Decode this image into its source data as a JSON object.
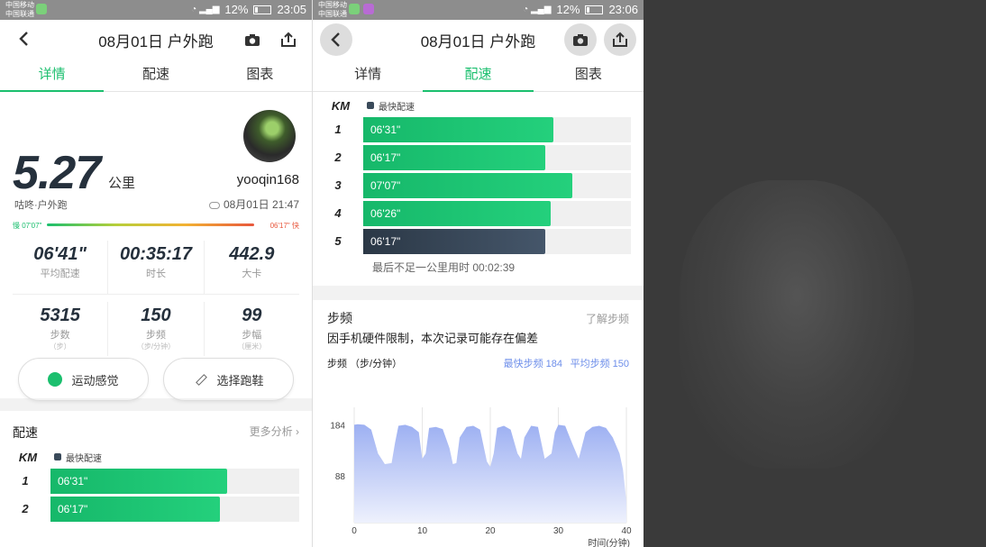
{
  "status": {
    "carrier1": "中国移动",
    "carrier2": "中国联通",
    "battery": "12%",
    "time_left": "23:05",
    "time_right": "23:06",
    "net": "4G"
  },
  "header": {
    "title": "08月01日 户外跑"
  },
  "tabs": [
    {
      "label": "详情"
    },
    {
      "label": "配速"
    },
    {
      "label": "图表"
    }
  ],
  "summary": {
    "distance": "5.27",
    "distance_unit": "公里",
    "subtype": "咕咚·户外跑",
    "username": "yooqin168",
    "datetime": "08月01日 21:47",
    "slow_label": "慢 07'07\"",
    "fast_label": "06'17\" 快"
  },
  "stats_row1": [
    {
      "value": "06'41\"",
      "label": "平均配速",
      "unit": ""
    },
    {
      "value": "00:35:17",
      "label": "时长",
      "unit": ""
    },
    {
      "value": "442.9",
      "label": "大卡",
      "unit": ""
    }
  ],
  "stats_row2": [
    {
      "value": "5315",
      "label": "步数",
      "unit": "（步）"
    },
    {
      "value": "150",
      "label": "步频",
      "unit": "（步/分钟）"
    },
    {
      "value": "99",
      "label": "步幅",
      "unit": "（厘米）"
    }
  ],
  "buttons": {
    "feel": "运动感觉",
    "shoes": "选择跑鞋"
  },
  "pace_section": {
    "title": "配速",
    "more": "更多分析 ›",
    "km": "KM",
    "legend": "最快配速"
  },
  "pace_rows": [
    {
      "km": "1",
      "pace": "06'31\"",
      "frac": 0.71,
      "fastest": false
    },
    {
      "km": "2",
      "pace": "06'17\"",
      "frac": 0.68,
      "fastest": false
    },
    {
      "km": "3",
      "pace": "07'07\"",
      "frac": 0.78,
      "fastest": false
    },
    {
      "km": "4",
      "pace": "06'26\"",
      "frac": 0.7,
      "fastest": false
    },
    {
      "km": "5",
      "pace": "06'17\"",
      "frac": 0.68,
      "fastest": true
    }
  ],
  "remain": "最后不足一公里用时 00:02:39",
  "cadence": {
    "title": "步频",
    "more": "了解步频",
    "note": "因手机硬件限制，本次记录可能存在偏差",
    "ylabel": "步频 （步/分钟）",
    "max_label": "最快步频 184",
    "avg_label": "平均步频 150"
  },
  "chart_data": {
    "type": "area",
    "title": "",
    "xlabel": "时间(分钟)",
    "ylabel": "步频 （步/分钟）",
    "x_ticks": [
      "0",
      "10",
      "20",
      "30",
      "40"
    ],
    "y_ticks": [
      "184",
      "88"
    ],
    "xlim": [
      0,
      40
    ],
    "ylim": [
      0,
      210
    ],
    "grid": true,
    "series": [
      {
        "x": [
          0,
          0.5,
          1.5,
          2.5,
          3.5,
          4.5,
          5.5,
          6,
          6.5,
          7.5,
          8.5,
          9.5,
          10,
          10.5,
          11,
          12,
          13,
          14,
          14.5,
          15,
          15.5,
          16.5,
          17.5,
          18.5,
          19.5,
          20,
          20.5,
          21,
          22,
          23,
          24,
          24.5,
          25,
          26,
          27,
          28,
          29,
          29.5,
          30,
          31,
          32,
          33,
          34,
          35,
          36,
          37,
          38,
          39,
          39.5,
          40
        ],
        "y": [
          184,
          185,
          184,
          175,
          130,
          110,
          112,
          150,
          182,
          184,
          180,
          170,
          120,
          130,
          178,
          180,
          176,
          140,
          110,
          112,
          160,
          180,
          182,
          175,
          115,
          105,
          130,
          178,
          182,
          175,
          130,
          120,
          160,
          182,
          180,
          120,
          130,
          170,
          184,
          182,
          150,
          120,
          170,
          180,
          182,
          178,
          160,
          130,
          100,
          40
        ]
      }
    ]
  }
}
